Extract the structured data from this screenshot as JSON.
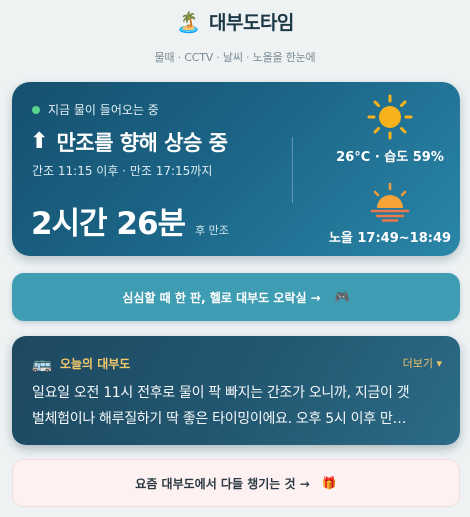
{
  "header": {
    "palm_icon": "🏝️",
    "title": "대부도타임",
    "subtitle": "물때 · CCTV · 날씨 · 노을을 한눈에"
  },
  "tide": {
    "live_label": "지금 물이 들어오는 중",
    "live_dot_color": "#5ad38d",
    "arrow_icon": "⬆",
    "status": "만조를 향해 상승 중",
    "times": "간조 11:15 이후 · 만조 17:15까지",
    "countdown": "2시간 26분",
    "countdown_suffix": "후 만조",
    "weather": "26°C · 습도 59%",
    "sunset": "노을 17:49~18:49",
    "weather_icon": "sun-icon",
    "sunset_icon": "sunset-icon"
  },
  "arcade": {
    "label": "심심할 때 한 판, 헬로 대부도 오락실 →",
    "icon": "🎮"
  },
  "today": {
    "icon": "🚌",
    "title": "오늘의 대부도",
    "more": "더보기 ▾",
    "line1": "일요일 오전 11시 전후로 물이 팍 빠지는 간조가 오니까, 지금이 갯",
    "line2": "벌체험이나 해루질하기 딱 좋은 타이밍이에요. 오후 5시 이후 만…"
  },
  "gift": {
    "label": "요즘 대부도에서 다들 챙기는 것 →",
    "icon": "🎁"
  },
  "colors": {
    "background": "#eef2f3",
    "accent_gold": "#f0c36a",
    "sun": "#f7b21c"
  }
}
